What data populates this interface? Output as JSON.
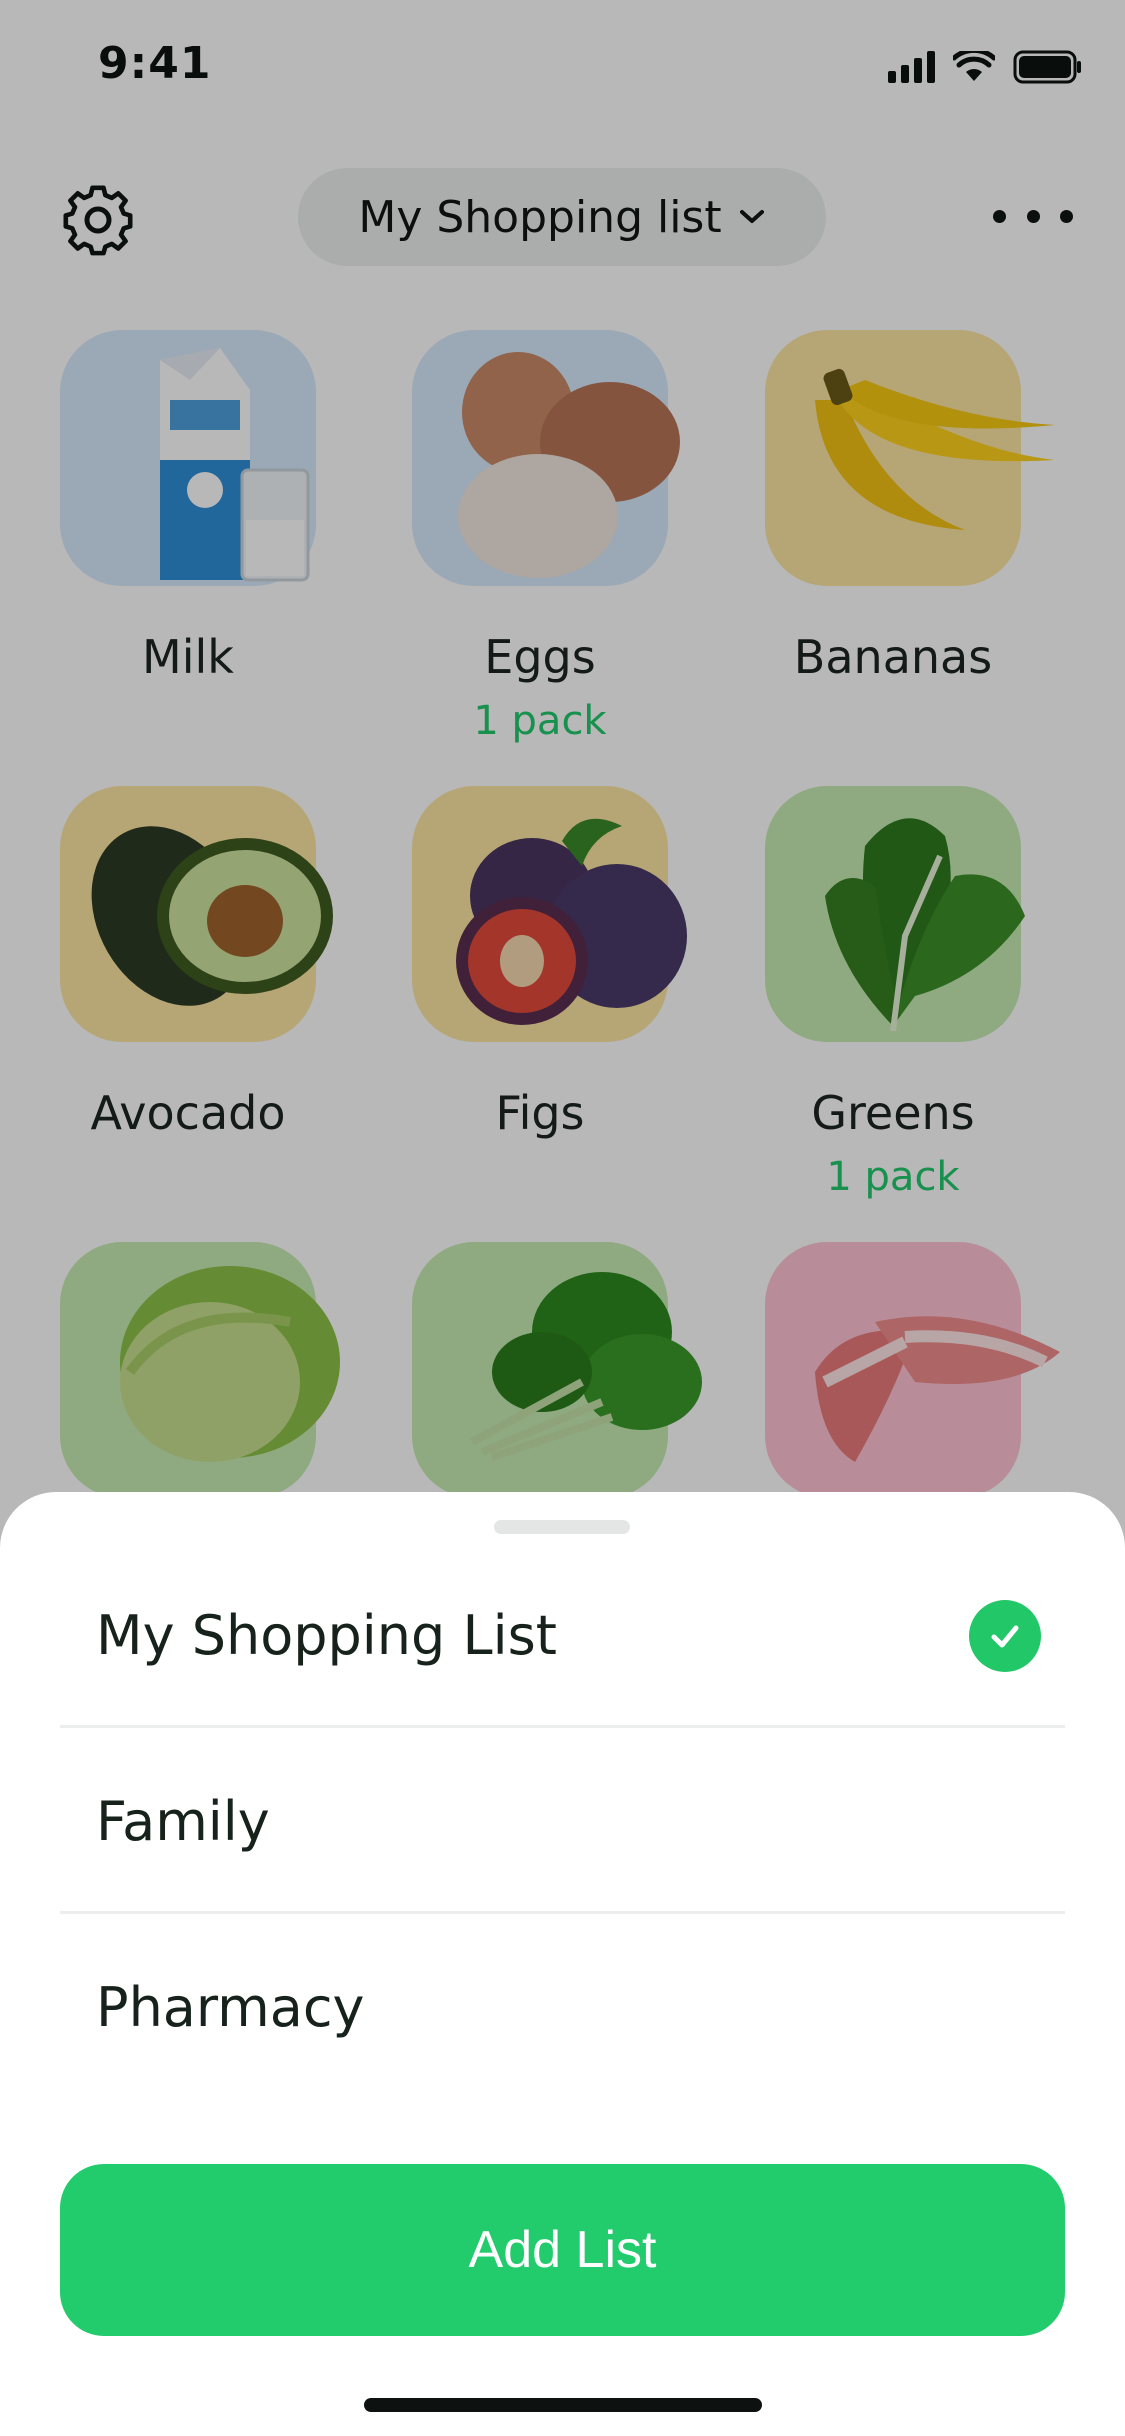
{
  "status_bar": {
    "time": "9:41",
    "icons": [
      "signal-icon",
      "wifi-icon",
      "battery-icon"
    ]
  },
  "header": {
    "settings_icon": "gear-icon",
    "list_selector": {
      "label": "My Shopping list",
      "icon": "chevron-down-icon"
    },
    "more_icon": "more-horizontal-icon"
  },
  "items": [
    {
      "name": "Milk",
      "qty": "",
      "color": "#d7e9fb"
    },
    {
      "name": "Eggs",
      "qty": "1 pack",
      "color": "#d7e9fb"
    },
    {
      "name": "Bananas",
      "qty": "",
      "color": "#fde6a4"
    },
    {
      "name": "Avocado",
      "qty": "",
      "color": "#fde6a4"
    },
    {
      "name": "Figs",
      "qty": "",
      "color": "#fde6a4"
    },
    {
      "name": "Greens",
      "qty": "1 pack",
      "color": "#c6ecb2"
    },
    {
      "name": "",
      "qty": "",
      "color": "#c6ecb2"
    },
    {
      "name": "",
      "qty": "",
      "color": "#c6ecb2"
    },
    {
      "name": "",
      "qty": "",
      "color": "#ffc4d4"
    }
  ],
  "sheet": {
    "options": [
      {
        "label": "My Shopping List",
        "selected": true
      },
      {
        "label": "Family",
        "selected": false
      },
      {
        "label": "Pharmacy",
        "selected": false
      }
    ],
    "add_button": "Add List"
  },
  "colors": {
    "accent": "#22cc6c",
    "check": "#22c768",
    "qty_text": "#21c96b"
  }
}
